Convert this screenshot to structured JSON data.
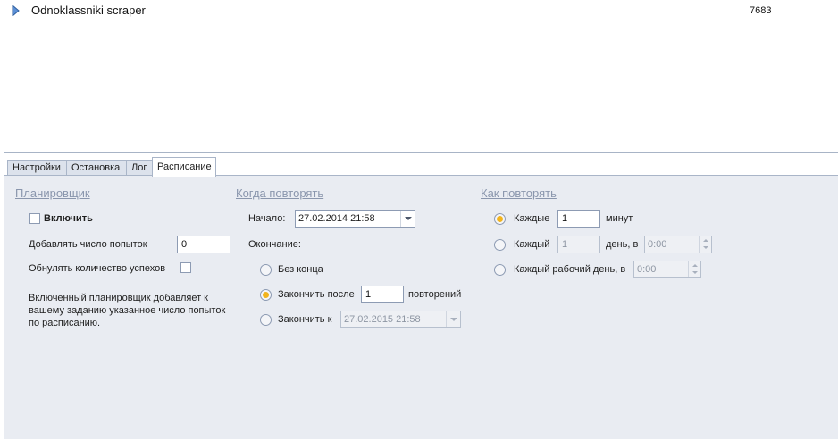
{
  "task_list": {
    "rows": [
      {
        "name": "Odnoklassniki scraper",
        "count": "7683"
      }
    ]
  },
  "tabs": [
    {
      "label": "Настройки",
      "active": false
    },
    {
      "label": "Остановка",
      "active": false
    },
    {
      "label": "Лог",
      "active": false
    },
    {
      "label": "Расписание",
      "active": true
    }
  ],
  "scheduler": {
    "title": "Планировщик",
    "enable_label": "Включить",
    "enable_checked": false,
    "add_attempts_label": "Добавлять число попыток",
    "add_attempts_value": "0",
    "reset_success_label": "Обнулять количество успехов",
    "reset_success_checked": false,
    "description": "Включенный планировщик добавляет к вашему заданию указанное число попыток по расписанию."
  },
  "when_repeat": {
    "title": "Когда повторять",
    "start_label": "Начало:",
    "start_value": "27.02.2014 21:58",
    "end_label": "Окончание:",
    "no_end_label": "Без конца",
    "end_after_label": "Закончить после",
    "end_after_value": "1",
    "repeats_label": "повторений",
    "end_by_label": "Закончить к",
    "end_by_value": "27.02.2015 21:58",
    "selected": "end_after"
  },
  "how_repeat": {
    "title": "Как повторять",
    "every_label": "Каждые",
    "every_value": "1",
    "minutes_label": "минут",
    "every_day_label": "Каждый",
    "every_day_value": "1",
    "day_at_label": "день, в",
    "day_time": "0:00",
    "workday_label": "Каждый рабочий день, в",
    "workday_time": "0:00",
    "selected": "every_minutes"
  },
  "colors": {
    "panel_bg": "#e9ecf2",
    "section_title": "#8a96ad",
    "radio_selected": "#f2b41e",
    "border": "#a9b5c8"
  }
}
